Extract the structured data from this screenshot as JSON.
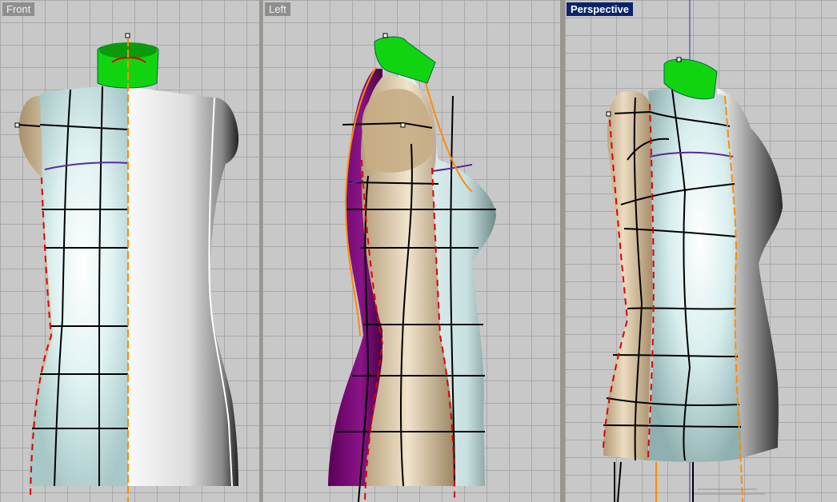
{
  "viewports": [
    {
      "name": "Front",
      "active": false
    },
    {
      "name": "Left",
      "active": false
    },
    {
      "name": "Perspective",
      "active": true
    }
  ],
  "colors": {
    "grid_bg": "#c8c8c8",
    "grid_line": "#a9a9a9",
    "active_label_bg": "#0a246a",
    "neck_green": "#00cc00",
    "skin_tan": "#cdb89a",
    "light_cyan": "#d6ecec",
    "purple": "#7a0a78",
    "seam_red": "#e00000",
    "axis_orange": "#ff8c00"
  }
}
